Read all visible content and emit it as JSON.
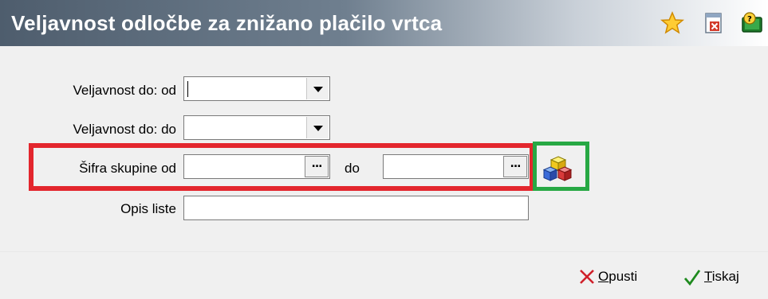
{
  "window": {
    "title": "Veljavnost odločbe za znižano plačilo vrtca"
  },
  "toolbar": {
    "icons": [
      "star-icon",
      "close-document-icon",
      "help-book-icon"
    ]
  },
  "form": {
    "valid_from_label": "Veljavnost do: od",
    "valid_from_value": "",
    "valid_to_label": "Veljavnost do: do",
    "valid_to_value": "",
    "group_from_label": "Šifra skupine od",
    "group_from_value": "",
    "group_to_label": "do",
    "group_to_value": "",
    "list_desc_label": "Opis liste",
    "list_desc_value": "",
    "lookup_button_label": "..."
  },
  "footer": {
    "cancel_first": "O",
    "cancel_rest": "pusti",
    "print_first": "T",
    "print_rest": "iskaj"
  },
  "colors": {
    "highlight_red": "#e3262d",
    "highlight_green": "#27a844"
  }
}
